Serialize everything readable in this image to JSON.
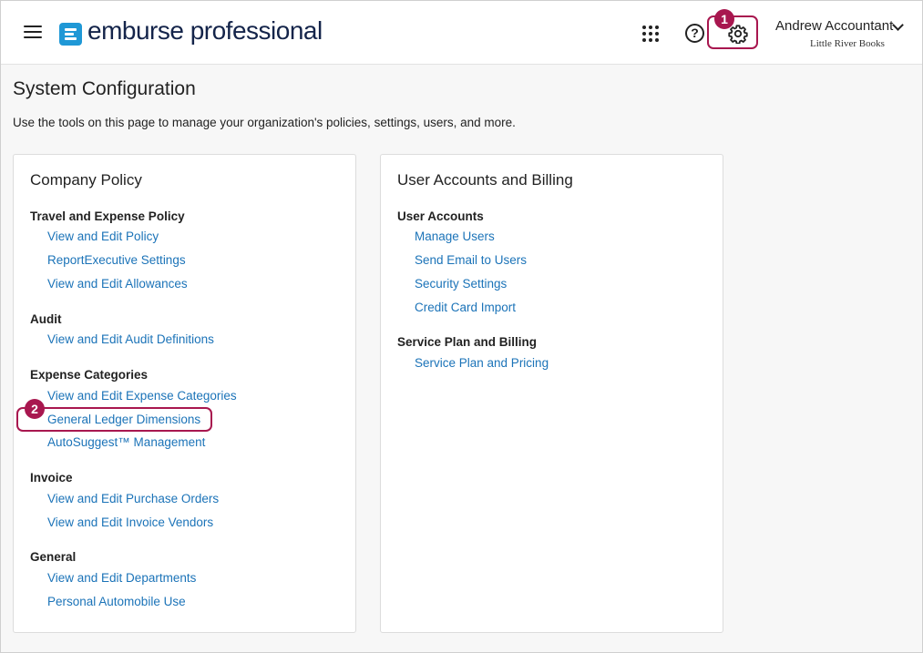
{
  "header": {
    "brand": "emburse professional",
    "user_name": "Andrew Accountant",
    "org_name": "Little River Books",
    "callout_1": "1"
  },
  "page": {
    "title": "System Configuration",
    "description": "Use the tools on this page to manage your organization's policies, settings, users, and more."
  },
  "company_policy": {
    "title": "Company Policy",
    "travel": {
      "heading": "Travel and Expense Policy",
      "links": [
        "View and Edit Policy",
        "ReportExecutive Settings",
        "View and Edit Allowances"
      ]
    },
    "audit": {
      "heading": "Audit",
      "links": [
        "View and Edit Audit Definitions"
      ]
    },
    "expense_categories": {
      "heading": "Expense Categories",
      "links": [
        "View and Edit Expense Categories",
        "General Ledger Dimensions",
        "AutoSuggest™ Management"
      ]
    },
    "invoice": {
      "heading": "Invoice",
      "links": [
        "View and Edit Purchase Orders",
        "View and Edit Invoice Vendors"
      ]
    },
    "general": {
      "heading": "General",
      "links": [
        "View and Edit Departments",
        "Personal Automobile Use"
      ]
    },
    "callout_2": "2"
  },
  "user_accounts_billing": {
    "title": "User Accounts and Billing",
    "user_accounts": {
      "heading": "User Accounts",
      "links": [
        "Manage Users",
        "Send Email to Users",
        "Security Settings",
        "Credit Card Import"
      ]
    },
    "service_plan": {
      "heading": "Service Plan and Billing",
      "links": [
        "Service Plan and Pricing"
      ]
    }
  },
  "colors": {
    "accent": "#a8174f",
    "link": "#1b73b8",
    "brand_blue": "#1f98d6"
  }
}
